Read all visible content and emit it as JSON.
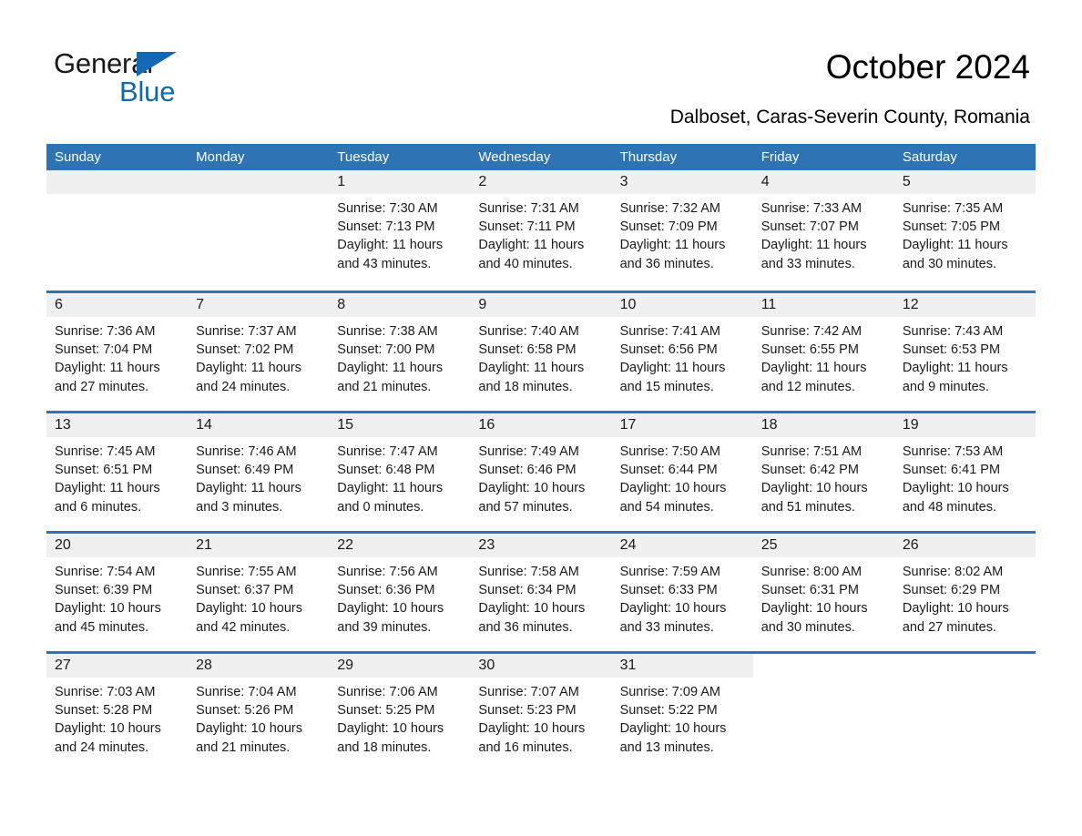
{
  "brand": {
    "name_part1": "General",
    "name_part2": "Blue",
    "triangle_color": "#1268b3",
    "text_color": "#1a1a1a"
  },
  "header": {
    "title": "October 2024",
    "subtitle": "Dalboset, Caras-Severin County, Romania"
  },
  "theme": {
    "header_blue": "#2e74b5",
    "day_band_gray": "#f0f0f0",
    "text_black": "#1a1a1a",
    "white": "#ffffff"
  },
  "calendar": {
    "weekdays": [
      "Sunday",
      "Monday",
      "Tuesday",
      "Wednesday",
      "Thursday",
      "Friday",
      "Saturday"
    ],
    "labels": {
      "sunrise": "Sunrise:",
      "sunset": "Sunset:",
      "daylight": "Daylight:"
    },
    "weeks": [
      [
        {
          "day": "",
          "sunrise": "",
          "sunset": "",
          "daylight": "",
          "empty": true
        },
        {
          "day": "",
          "sunrise": "",
          "sunset": "",
          "daylight": "",
          "empty": true
        },
        {
          "day": "1",
          "sunrise": "Sunrise: 7:30 AM",
          "sunset": "Sunset: 7:13 PM",
          "daylight": "Daylight: 11 hours and 43 minutes."
        },
        {
          "day": "2",
          "sunrise": "Sunrise: 7:31 AM",
          "sunset": "Sunset: 7:11 PM",
          "daylight": "Daylight: 11 hours and 40 minutes."
        },
        {
          "day": "3",
          "sunrise": "Sunrise: 7:32 AM",
          "sunset": "Sunset: 7:09 PM",
          "daylight": "Daylight: 11 hours and 36 minutes."
        },
        {
          "day": "4",
          "sunrise": "Sunrise: 7:33 AM",
          "sunset": "Sunset: 7:07 PM",
          "daylight": "Daylight: 11 hours and 33 minutes."
        },
        {
          "day": "5",
          "sunrise": "Sunrise: 7:35 AM",
          "sunset": "Sunset: 7:05 PM",
          "daylight": "Daylight: 11 hours and 30 minutes."
        }
      ],
      [
        {
          "day": "6",
          "sunrise": "Sunrise: 7:36 AM",
          "sunset": "Sunset: 7:04 PM",
          "daylight": "Daylight: 11 hours and 27 minutes."
        },
        {
          "day": "7",
          "sunrise": "Sunrise: 7:37 AM",
          "sunset": "Sunset: 7:02 PM",
          "daylight": "Daylight: 11 hours and 24 minutes."
        },
        {
          "day": "8",
          "sunrise": "Sunrise: 7:38 AM",
          "sunset": "Sunset: 7:00 PM",
          "daylight": "Daylight: 11 hours and 21 minutes."
        },
        {
          "day": "9",
          "sunrise": "Sunrise: 7:40 AM",
          "sunset": "Sunset: 6:58 PM",
          "daylight": "Daylight: 11 hours and 18 minutes."
        },
        {
          "day": "10",
          "sunrise": "Sunrise: 7:41 AM",
          "sunset": "Sunset: 6:56 PM",
          "daylight": "Daylight: 11 hours and 15 minutes."
        },
        {
          "day": "11",
          "sunrise": "Sunrise: 7:42 AM",
          "sunset": "Sunset: 6:55 PM",
          "daylight": "Daylight: 11 hours and 12 minutes."
        },
        {
          "day": "12",
          "sunrise": "Sunrise: 7:43 AM",
          "sunset": "Sunset: 6:53 PM",
          "daylight": "Daylight: 11 hours and 9 minutes."
        }
      ],
      [
        {
          "day": "13",
          "sunrise": "Sunrise: 7:45 AM",
          "sunset": "Sunset: 6:51 PM",
          "daylight": "Daylight: 11 hours and 6 minutes."
        },
        {
          "day": "14",
          "sunrise": "Sunrise: 7:46 AM",
          "sunset": "Sunset: 6:49 PM",
          "daylight": "Daylight: 11 hours and 3 minutes."
        },
        {
          "day": "15",
          "sunrise": "Sunrise: 7:47 AM",
          "sunset": "Sunset: 6:48 PM",
          "daylight": "Daylight: 11 hours and 0 minutes."
        },
        {
          "day": "16",
          "sunrise": "Sunrise: 7:49 AM",
          "sunset": "Sunset: 6:46 PM",
          "daylight": "Daylight: 10 hours and 57 minutes."
        },
        {
          "day": "17",
          "sunrise": "Sunrise: 7:50 AM",
          "sunset": "Sunset: 6:44 PM",
          "daylight": "Daylight: 10 hours and 54 minutes."
        },
        {
          "day": "18",
          "sunrise": "Sunrise: 7:51 AM",
          "sunset": "Sunset: 6:42 PM",
          "daylight": "Daylight: 10 hours and 51 minutes."
        },
        {
          "day": "19",
          "sunrise": "Sunrise: 7:53 AM",
          "sunset": "Sunset: 6:41 PM",
          "daylight": "Daylight: 10 hours and 48 minutes."
        }
      ],
      [
        {
          "day": "20",
          "sunrise": "Sunrise: 7:54 AM",
          "sunset": "Sunset: 6:39 PM",
          "daylight": "Daylight: 10 hours and 45 minutes."
        },
        {
          "day": "21",
          "sunrise": "Sunrise: 7:55 AM",
          "sunset": "Sunset: 6:37 PM",
          "daylight": "Daylight: 10 hours and 42 minutes."
        },
        {
          "day": "22",
          "sunrise": "Sunrise: 7:56 AM",
          "sunset": "Sunset: 6:36 PM",
          "daylight": "Daylight: 10 hours and 39 minutes."
        },
        {
          "day": "23",
          "sunrise": "Sunrise: 7:58 AM",
          "sunset": "Sunset: 6:34 PM",
          "daylight": "Daylight: 10 hours and 36 minutes."
        },
        {
          "day": "24",
          "sunrise": "Sunrise: 7:59 AM",
          "sunset": "Sunset: 6:33 PM",
          "daylight": "Daylight: 10 hours and 33 minutes."
        },
        {
          "day": "25",
          "sunrise": "Sunrise: 8:00 AM",
          "sunset": "Sunset: 6:31 PM",
          "daylight": "Daylight: 10 hours and 30 minutes."
        },
        {
          "day": "26",
          "sunrise": "Sunrise: 8:02 AM",
          "sunset": "Sunset: 6:29 PM",
          "daylight": "Daylight: 10 hours and 27 minutes."
        }
      ],
      [
        {
          "day": "27",
          "sunrise": "Sunrise: 7:03 AM",
          "sunset": "Sunset: 5:28 PM",
          "daylight": "Daylight: 10 hours and 24 minutes."
        },
        {
          "day": "28",
          "sunrise": "Sunrise: 7:04 AM",
          "sunset": "Sunset: 5:26 PM",
          "daylight": "Daylight: 10 hours and 21 minutes."
        },
        {
          "day": "29",
          "sunrise": "Sunrise: 7:06 AM",
          "sunset": "Sunset: 5:25 PM",
          "daylight": "Daylight: 10 hours and 18 minutes."
        },
        {
          "day": "30",
          "sunrise": "Sunrise: 7:07 AM",
          "sunset": "Sunset: 5:23 PM",
          "daylight": "Daylight: 10 hours and 16 minutes."
        },
        {
          "day": "31",
          "sunrise": "Sunrise: 7:09 AM",
          "sunset": "Sunset: 5:22 PM",
          "daylight": "Daylight: 10 hours and 13 minutes."
        },
        {
          "day": "",
          "sunrise": "",
          "sunset": "",
          "daylight": "",
          "empty": true,
          "blank": true
        },
        {
          "day": "",
          "sunrise": "",
          "sunset": "",
          "daylight": "",
          "empty": true,
          "blank": true
        }
      ]
    ]
  }
}
